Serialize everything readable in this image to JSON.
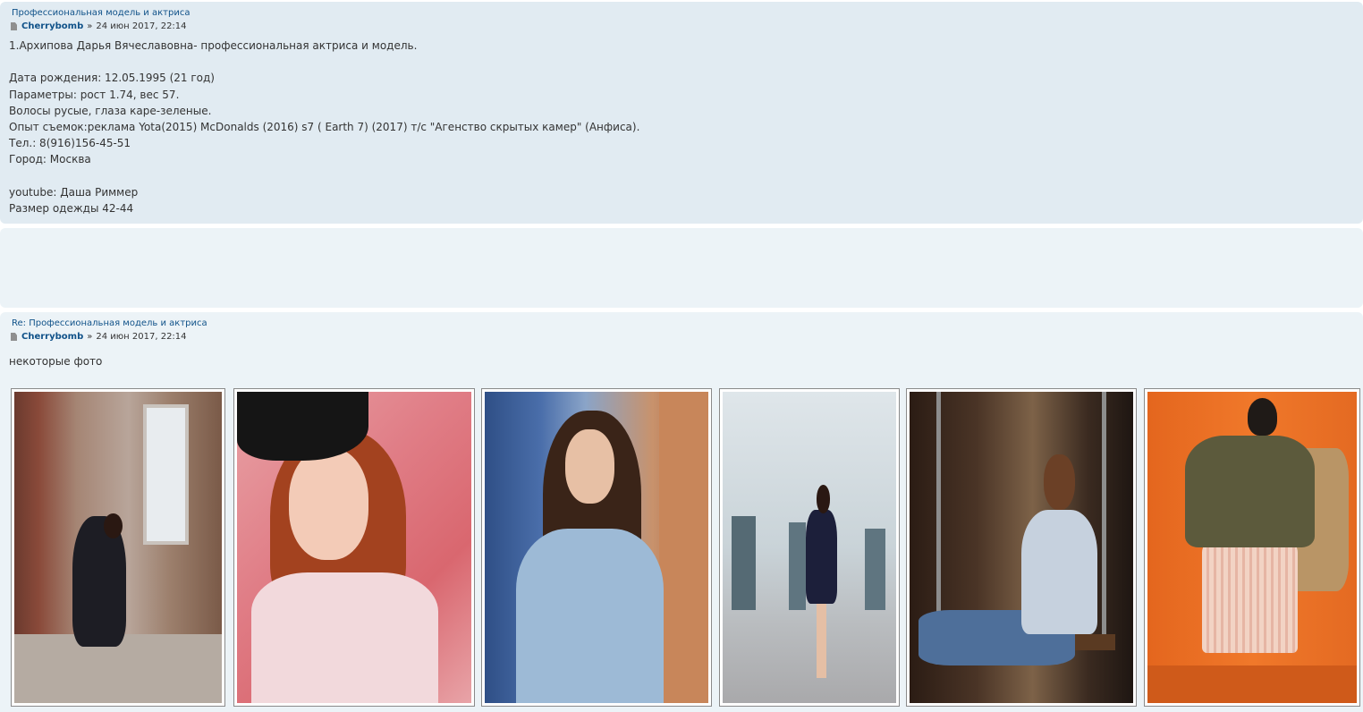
{
  "post1": {
    "title": "Профессиональная модель и актриса",
    "author": "Cherrybomb",
    "separator": "»",
    "date": "24 июн 2017, 22:14",
    "body": "1.Архипова Дарья Вячеславовна- профессиональная актриса и модель.\n\nДата рождения: 12.05.1995 (21 год)\nПараметры: рост 1.74, вес 57.\nВолосы русые, глаза каре-зеленые.\nОпыт съемок:реклама Yota(2015) McDonalds (2016) s7 ( Earth 7) (2017) т/с \"Агенство скрытых камер\" (Анфиса).\nТел.: 8(916)156-45-51\nГород: Москва\n\nyoutube: Даша Риммер\nРазмер одежды 42-44"
  },
  "post2": {
    "title": "Re: Профессиональная модель и актриса",
    "author": "Cherrybomb",
    "separator": "»",
    "date": "24 июн 2017, 22:14",
    "body": "некоторые фото"
  },
  "icons": {
    "post_icon": "file-icon"
  },
  "colors": {
    "post_bg_1": "#e1ebf2",
    "post_bg_2": "#ecf3f7",
    "link": "#105289"
  }
}
